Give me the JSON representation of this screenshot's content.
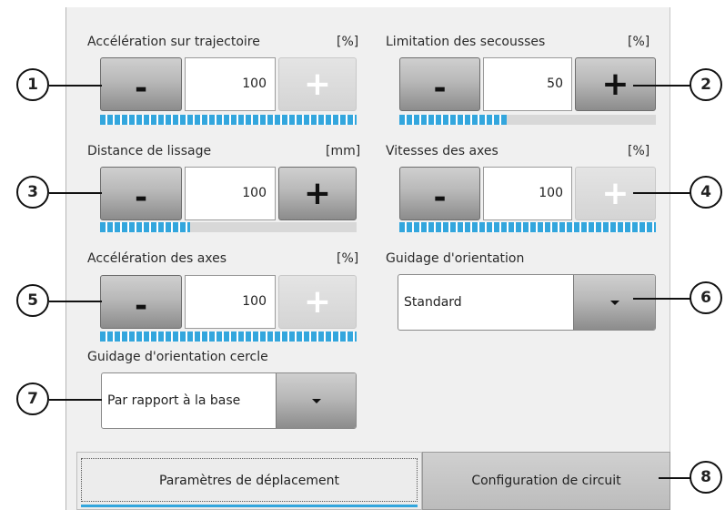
{
  "sliders": {
    "path_accel": {
      "label": "Accélération sur trajectoire",
      "unit": "[%]",
      "value": "100",
      "minus": "-",
      "plus": "+",
      "level": 1.0
    },
    "jerk_limit": {
      "label": "Limitation des secousses",
      "unit": "[%]",
      "value": "50",
      "minus": "-",
      "plus": "+",
      "level": 0.42
    },
    "smoothing": {
      "label": "Distance de lissage",
      "unit": "[mm]",
      "value": "100",
      "minus": "-",
      "plus": "+",
      "level": 0.35
    },
    "axis_speed": {
      "label": "Vitesses des axes",
      "unit": "[%]",
      "value": "100",
      "minus": "-",
      "plus": "+",
      "level": 1.0
    },
    "axis_accel": {
      "label": "Accélération des axes",
      "unit": "[%]",
      "value": "100",
      "minus": "-",
      "plus": "+",
      "level": 1.0
    }
  },
  "orientation": {
    "label": "Guidage d'orientation",
    "selected": "Standard"
  },
  "circle_orientation": {
    "label": "Guidage d'orientation cercle",
    "selected": "Par rapport à la base"
  },
  "tabs": {
    "motion_params": "Paramètres de déplacement",
    "circuit_config": "Configuration de circuit"
  },
  "callouts": [
    "1",
    "2",
    "3",
    "4",
    "5",
    "6",
    "7",
    "8"
  ],
  "colors": {
    "progress": "#33a6dd",
    "panel": "#f0f0f0"
  }
}
